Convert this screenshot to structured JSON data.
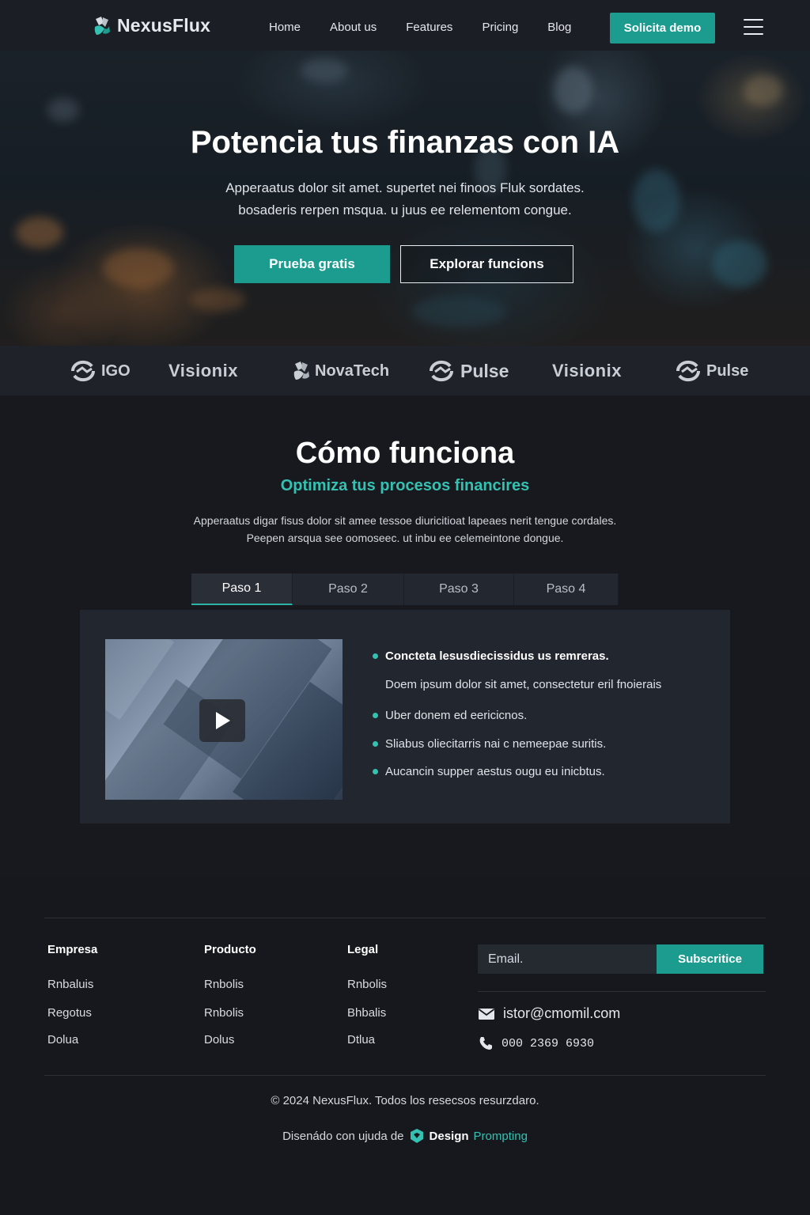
{
  "nav": {
    "brand": "NexusFlux",
    "links": [
      "Home",
      "About us",
      "Features",
      "Pricing",
      "Blog"
    ],
    "cta": "Solicita demo",
    "menu_icon": "hamburger-icon"
  },
  "hero": {
    "title": "Potencia tus finanzas con IA",
    "subtitle_lines": [
      "Apperaatus dolor sit amet. supertet nei finoos Fluk sordates.",
      "bosaderis rerpen msqua. u juus ee relementom congue."
    ],
    "primary_button": "Prueba gratis",
    "secondary_button": "Explorar funcions"
  },
  "logos": [
    {
      "name": "IGO",
      "icon": "swirl-logo-icon"
    },
    {
      "name": "Visionix",
      "icon": "none"
    },
    {
      "name": "NovaTech",
      "icon": "leaf-logo-icon"
    },
    {
      "name": "Pulse",
      "icon": "swirl-logo-icon"
    },
    {
      "name": "Visionix",
      "icon": "none"
    },
    {
      "name": "Pulse",
      "icon": "swirl-logo-icon"
    }
  ],
  "how": {
    "title": "Cómo funciona",
    "subtitle": "Optimiza tus procesos financires",
    "description_lines": [
      "Apperaatus digar fisus dolor sit amee tessoe diuricitioat lapeaes nerit tengue cordales.",
      "Peepen arsqua see oomoseec. ut inbu ee celemeintone dongue."
    ],
    "tabs": [
      "Paso 1",
      "Paso 2",
      "Paso 3",
      "Paso 4"
    ],
    "active_tab": "Paso 1",
    "video_icon": "play-icon",
    "step_heading": "Concteta lesusdiecissidus us remreras.",
    "step_detail": "Doem ipsum dolor sit amet, consectetur eril fnoierais",
    "step_items": [
      "Uber donem ed eericicnos.",
      "Sliabus oliecitarris nai c nemeepae suritis.",
      "Aucancin supper aestus ougu eu inicbtus."
    ]
  },
  "footer": {
    "columns": [
      {
        "title": "Empresa",
        "links": [
          "Rnbaluis",
          "Regotus",
          "Dolua"
        ]
      },
      {
        "title": "Producto",
        "links": [
          "Rnbolis",
          "Rnbolis",
          "Dolus"
        ]
      },
      {
        "title": "Legal",
        "links": [
          "Rnbolis",
          "Bhbalis",
          "Dtlua"
        ]
      }
    ],
    "email_placeholder": "Email.",
    "subscribe_label": "Subscritice",
    "contact_email": "istor@cmomil.com",
    "contact_phone": "000 2369 6930",
    "copyright": "© 2024 NexusFlux. Todos los resecsos resurzdaro.",
    "designed_prefix": "Disenádo con ujuda de",
    "designed_brand": "Design",
    "designed_brand_accent": "Prompting"
  },
  "colors": {
    "accent": "#1c9c8e",
    "accent_text": "#35c1b1",
    "background": "#17191f",
    "nav_background": "#1b1e24"
  }
}
